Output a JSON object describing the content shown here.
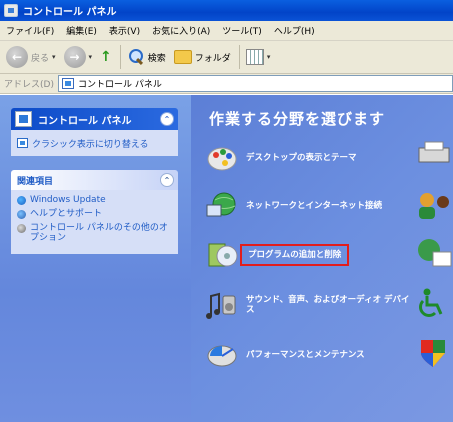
{
  "window": {
    "title": "コントロール パネル"
  },
  "menu": [
    "ファイル(F)",
    "編集(E)",
    "表示(V)",
    "お気に入り(A)",
    "ツール(T)",
    "ヘルプ(H)"
  ],
  "toolbar": {
    "back": "戻る",
    "search": "検索",
    "folders": "フォルダ"
  },
  "address": {
    "label": "アドレス(D)",
    "value": "コントロール パネル"
  },
  "sidebar": {
    "panel_title": "コントロール パネル",
    "switch_link": "クラシック表示に切り替える",
    "related_title": "関連項目",
    "related_items": [
      "Windows Update",
      "ヘルプとサポート",
      "コントロール パネルのその他のオプション"
    ]
  },
  "main": {
    "heading": "作業する分野を選びます",
    "categories": [
      "デスクトップの表示とテーマ",
      "ネットワークとインターネット接続",
      "プログラムの追加と削除",
      "サウンド、音声、およびオーディオ デバイス",
      "パフォーマンスとメンテナンス"
    ],
    "highlighted": "プログラムの追加と削除",
    "highlight_color": "#e21d1d"
  }
}
